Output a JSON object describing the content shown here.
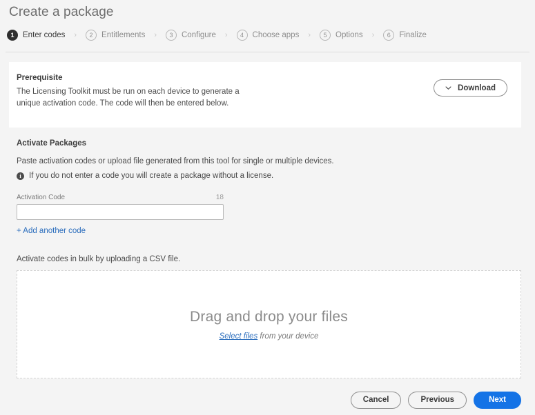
{
  "header": {
    "title": "Create a package"
  },
  "stepper": {
    "separator": "›",
    "steps": [
      {
        "number": "1",
        "label": "Enter codes",
        "active": true
      },
      {
        "number": "2",
        "label": "Entitlements",
        "active": false
      },
      {
        "number": "3",
        "label": "Configure",
        "active": false
      },
      {
        "number": "4",
        "label": "Choose apps",
        "active": false
      },
      {
        "number": "5",
        "label": "Options",
        "active": false
      },
      {
        "number": "6",
        "label": "Finalize",
        "active": false
      }
    ]
  },
  "prerequisite": {
    "title": "Prerequisite",
    "text": "The Licensing Toolkit must be run on each device to generate a unique activation code. The code will then be entered below.",
    "download_label": "Download",
    "download_icon": "chevron-down-icon"
  },
  "activate": {
    "title": "Activate Packages",
    "description": "Paste activation codes or upload file generated from this tool for single or multiple devices.",
    "note_icon": "info-icon",
    "note_icon_glyph": "i",
    "note": "If you do not enter a code you will create a package without a license.",
    "field_label": "Activation Code",
    "field_counter": "18",
    "field_value": "",
    "field_placeholder": "",
    "add_another_label": "+ Add another code"
  },
  "bulk": {
    "label": "Activate codes in bulk by uploading a CSV file.",
    "dropzone_title": "Drag and drop your files",
    "dropzone_link": "Select files",
    "dropzone_suffix": " from your device"
  },
  "footer": {
    "cancel_label": "Cancel",
    "previous_label": "Previous",
    "next_label": "Next"
  },
  "colors": {
    "accent": "#1473E6",
    "link": "#2C6EBD",
    "page_background": "#F4F4F4",
    "card_background": "#FFFFFF",
    "step_active": "#2E2E2E"
  }
}
